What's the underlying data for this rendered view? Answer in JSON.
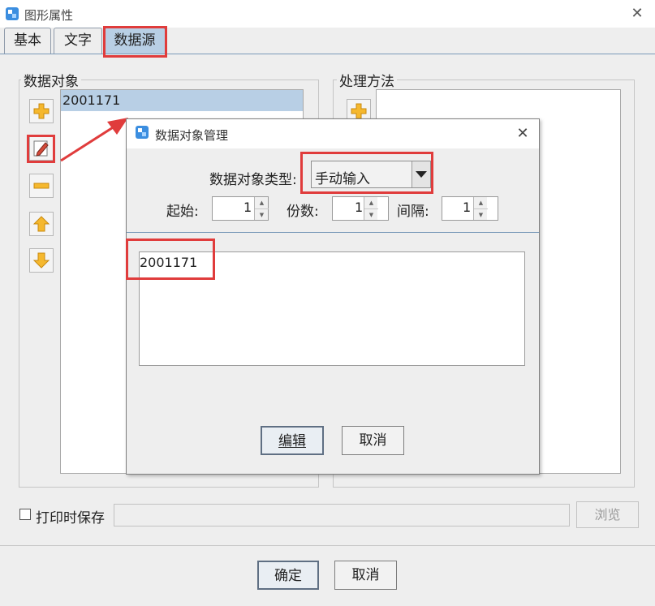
{
  "window": {
    "title": "图形属性",
    "close_glyph": "✕"
  },
  "tabs": [
    {
      "label": "基本"
    },
    {
      "label": "文字"
    },
    {
      "label": "数据源"
    }
  ],
  "data_objects": {
    "group_label": "数据对象",
    "items": [
      "2001171"
    ]
  },
  "processing": {
    "group_label": "处理方法"
  },
  "save_on_print": {
    "label": "打印时保存",
    "checked": false,
    "browse_label": "浏览"
  },
  "footer": {
    "ok_label": "确定",
    "cancel_label": "取消"
  },
  "dialog": {
    "title": "数据对象管理",
    "close_glyph": "✕",
    "type_label": "数据对象类型:",
    "type_value": "手动输入",
    "start_label": "起始:",
    "start_value": "1",
    "copies_label": "份数:",
    "copies_value": "1",
    "interval_label": "间隔:",
    "interval_value": "1",
    "data_text": "2001171",
    "edit_label": "编辑",
    "cancel_label": "取消"
  },
  "colors": {
    "highlight": "#e03c3c",
    "selection": "#b8cfe5",
    "accent_line": "#7a9ab9"
  },
  "icons": {
    "add": "plus-icon",
    "edit": "pencil-icon",
    "remove": "minus-icon",
    "up": "arrow-up-icon",
    "down": "arrow-down-icon"
  }
}
